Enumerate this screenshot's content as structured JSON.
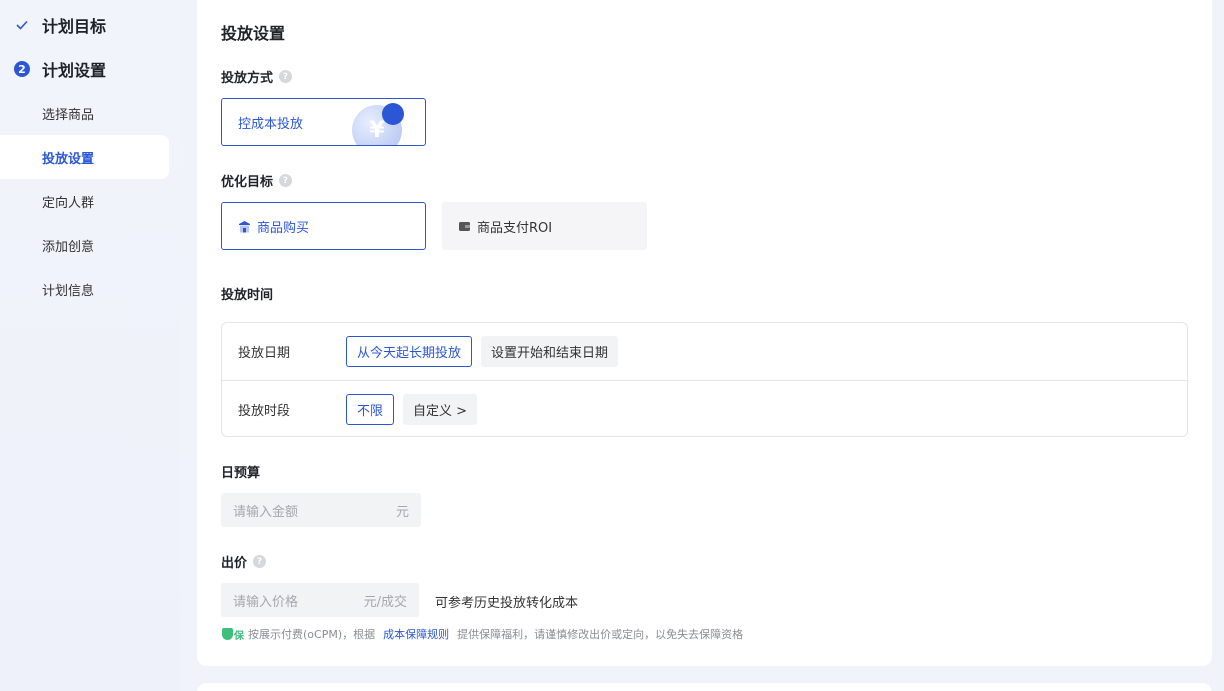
{
  "sidebar": {
    "steps": [
      {
        "label": "计划目标",
        "state": "done"
      },
      {
        "label": "计划设置",
        "number": "2",
        "state": "current"
      }
    ],
    "items": [
      {
        "label": "选择商品"
      },
      {
        "label": "投放设置",
        "active": true
      },
      {
        "label": "定向人群"
      },
      {
        "label": "添加创意"
      },
      {
        "label": "计划信息"
      }
    ]
  },
  "main": {
    "title": "投放设置",
    "delivery_method": {
      "label": "投放方式",
      "option": "控成本投放",
      "icon_glyph": "¥"
    },
    "optimization": {
      "label": "优化目标",
      "options": [
        {
          "label": "商品购买",
          "selected": true
        },
        {
          "label": "商品支付ROI",
          "selected": false
        }
      ]
    },
    "schedule": {
      "label": "投放时间",
      "date_row": {
        "label": "投放日期",
        "options": [
          "从今天起长期投放",
          "设置开始和结束日期"
        ]
      },
      "period_row": {
        "label": "投放时段",
        "options": [
          "不限",
          "自定义 >"
        ]
      }
    },
    "budget": {
      "label": "日预算",
      "placeholder": "请输入金额",
      "unit": "元"
    },
    "bid": {
      "label": "出价",
      "placeholder": "请输入价格",
      "unit": "元/成交",
      "hint": "可参考历史投放转化成本",
      "badge": "保",
      "note_prefix": "按展示付费(oCPM)，根据",
      "note_link": "成本保障规则",
      "note_suffix": "提供保障福利，请谨慎修改出价或定向，以免失去保障资格"
    }
  },
  "colors": {
    "accent": "#2b57d6",
    "background": "#f1f3fa",
    "guarantee_green": "#3fbf7a"
  }
}
